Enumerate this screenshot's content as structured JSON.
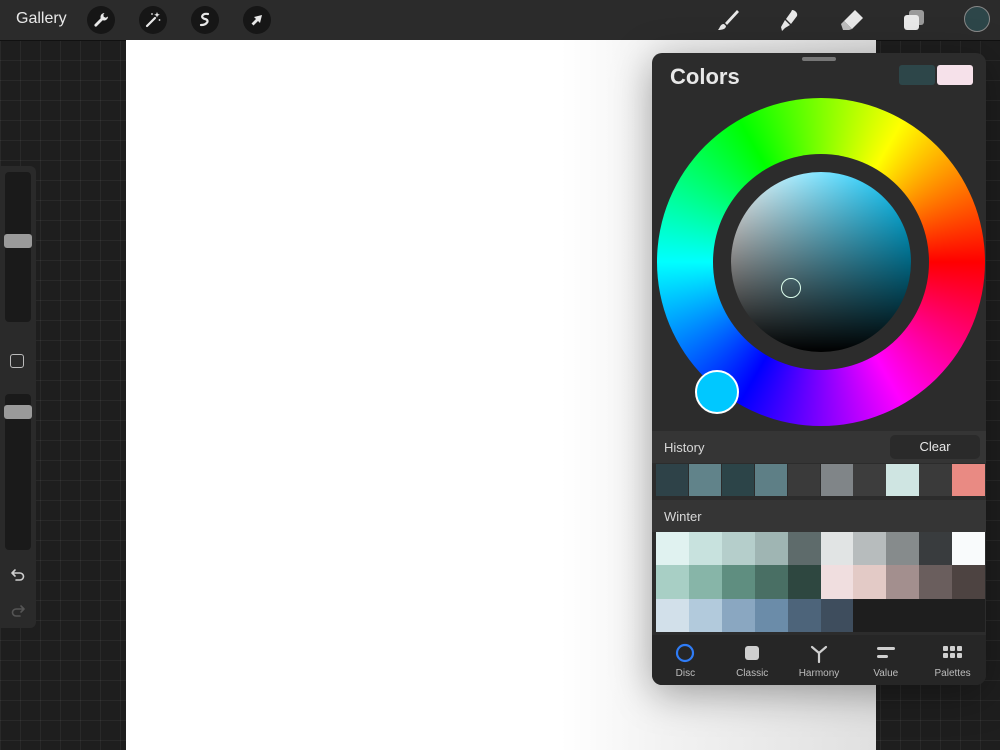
{
  "topbar": {
    "gallery_label": "Gallery",
    "left_tools": [
      "wrench-icon",
      "magic-wand-icon",
      "selection-icon",
      "transform-arrow-icon"
    ],
    "right_tools": [
      "brush-icon",
      "smudge-icon",
      "eraser-icon",
      "layers-icon"
    ],
    "active_color": "#2d4649"
  },
  "sidebar": {
    "brush_size_level": 0.55,
    "opacity_level": 0.05,
    "icons": [
      "modifier-square-icon",
      "undo-icon",
      "redo-icon"
    ]
  },
  "panel": {
    "title": "Colors",
    "current_color": "#2d4649",
    "previous_color": "#f6e1ea",
    "hue_knob_color": "#00c8ff",
    "history": {
      "label": "History",
      "clear_label": "Clear",
      "colors": [
        "#2e4248",
        "#61838a",
        "#2c4448",
        "#5e7f86",
        "#3a3a3a",
        "#808588",
        "#3d3d3d",
        "#cfe5e2",
        "#3a3a3a",
        "#e98a83"
      ]
    },
    "palette": {
      "name": "Winter",
      "colors": [
        "#e0f2f0",
        "#c8e2de",
        "#b5cecb",
        "#9fb5b3",
        "#5e6b6b",
        "#e1e4e4",
        "#b7bcbd",
        "#868b8c",
        "#393c3e",
        "#f9fbfc",
        "#a8cfc5",
        "#87b5a8",
        "#5f8e80",
        "#496f64",
        "#2e4740",
        "#f0dedf",
        "#e3cac6",
        "#a38f8e",
        "#6a5e5d",
        "#4d4341",
        "#d2e0ea",
        "#b2cadc",
        "#8aa7c1",
        "#6b8ca9",
        "#4d647a",
        "#3e4d5d",
        "#1e1e1e",
        "#1e1e1e",
        "#1e1e1e",
        "#1e1e1e"
      ]
    },
    "tabs": [
      {
        "label": "Disc",
        "icon": "disc-icon",
        "active": true
      },
      {
        "label": "Classic",
        "icon": "classic-square-icon",
        "active": false
      },
      {
        "label": "Harmony",
        "icon": "harmony-icon",
        "active": false
      },
      {
        "label": "Value",
        "icon": "value-sliders-icon",
        "active": false
      },
      {
        "label": "Palettes",
        "icon": "palettes-grid-icon",
        "active": false
      }
    ]
  }
}
